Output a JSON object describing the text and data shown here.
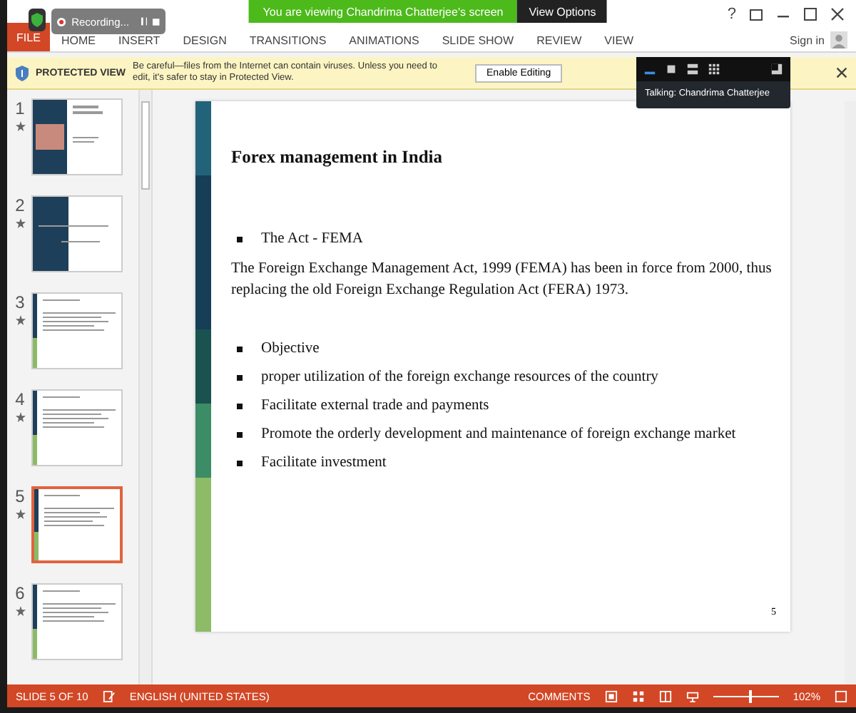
{
  "zoom_banner": {
    "text": "You are viewing Chandrima Chatterjee's screen",
    "options": "View Options"
  },
  "recording": {
    "label": "Recording..."
  },
  "ribbon": {
    "tabs": [
      {
        "label": "FILE",
        "kind": "file"
      },
      {
        "label": "HOME",
        "kind": "tab"
      },
      {
        "label": "INSERT",
        "kind": "tab"
      },
      {
        "label": "DESIGN",
        "kind": "tab"
      },
      {
        "label": "TRANSITIONS",
        "kind": "tab"
      },
      {
        "label": "ANIMATIONS",
        "kind": "tab"
      },
      {
        "label": "SLIDE SHOW",
        "kind": "tab"
      },
      {
        "label": "REVIEW",
        "kind": "tab"
      },
      {
        "label": "VIEW",
        "kind": "tab"
      }
    ],
    "help": "?",
    "sign_in": "Sign in"
  },
  "protected_view": {
    "title": "PROTECTED VIEW",
    "message": "Be careful—files from the Internet can contain viruses. Unless you need to edit, it's safer to stay in Protected View.",
    "button": "Enable Editing"
  },
  "speaker_panel": {
    "talking": "Talking: Chandrima Chatterjee"
  },
  "thumbnails": [
    {
      "number": "1",
      "kind": "title",
      "selected": false
    },
    {
      "number": "2",
      "kind": "section",
      "selected": false
    },
    {
      "number": "3",
      "kind": "content",
      "selected": false
    },
    {
      "number": "4",
      "kind": "content",
      "selected": false
    },
    {
      "number": "5",
      "kind": "content",
      "selected": true
    },
    {
      "number": "6",
      "kind": "content",
      "selected": false
    }
  ],
  "slide": {
    "title": "Forex management in India",
    "body": [
      {
        "kind": "bullet",
        "text": "The Act - FEMA"
      },
      {
        "kind": "paragraph",
        "text": "The Foreign Exchange Management Act, 1999 (FEMA) has been in force from 2000, thus replacing the old Foreign Exchange Regulation Act (FERA) 1973."
      },
      {
        "kind": "bullet",
        "text": "Objective"
      },
      {
        "kind": "bullet",
        "text": "proper utilization of the foreign exchange resources of the country"
      },
      {
        "kind": "bullet",
        "text": "Facilitate external trade and payments"
      },
      {
        "kind": "bullet",
        "text": "Promote the orderly development and maintenance of foreign exchange market"
      },
      {
        "kind": "bullet",
        "text": "Facilitate investment"
      }
    ],
    "page_number": "5"
  },
  "status_bar": {
    "slide_info": "SLIDE 5 OF 10",
    "language": "ENGLISH (UNITED STATES)",
    "comments": "COMMENTS",
    "zoom": {
      "level": 0.55
    },
    "zoom_percent": "102%"
  }
}
